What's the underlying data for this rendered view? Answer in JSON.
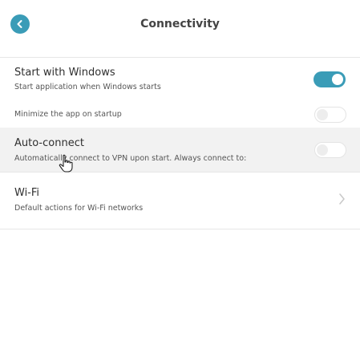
{
  "header": {
    "title": "Connectivity",
    "back_icon": "chevron-left-icon"
  },
  "colors": {
    "accent": "#3a9cb7",
    "highlight_row": "#f2f2f2"
  },
  "settings": {
    "start_with_windows": {
      "title": "Start with Windows",
      "subtitle": "Start application when Windows starts",
      "enabled": true
    },
    "minimize_on_startup": {
      "label": "Minimize the app on startup",
      "enabled": false
    },
    "auto_connect": {
      "title": "Auto-connect",
      "subtitle": "Automatically connect to VPN upon start. Always connect to:",
      "enabled": false
    },
    "wifi": {
      "title": "Wi-Fi",
      "subtitle": "Default actions for Wi-Fi networks",
      "chevron_icon": "chevron-right-icon"
    }
  },
  "cursor_icon": "hand-pointer-icon"
}
